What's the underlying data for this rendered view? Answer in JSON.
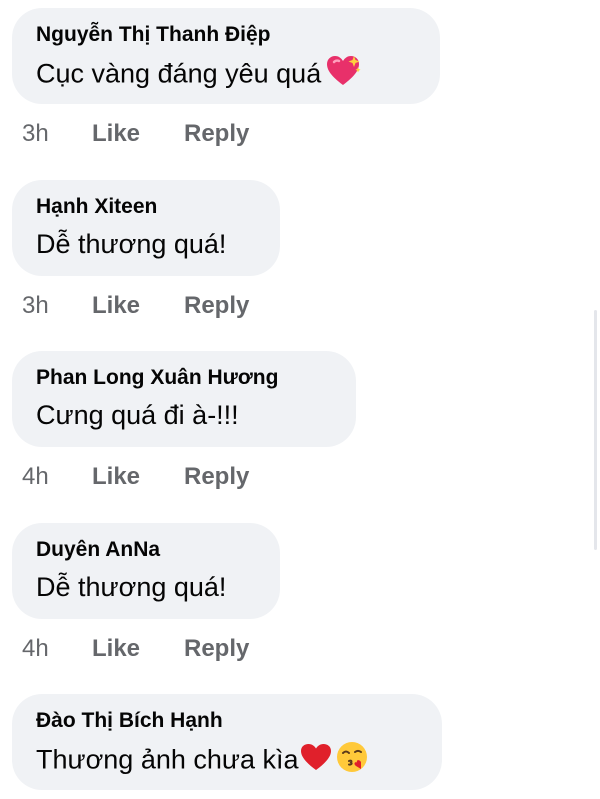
{
  "comments": [
    {
      "author": "Nguyễn Thị Thanh Điệp",
      "text": "Cục vàng đáng yêu quá",
      "emoji": "sparkling-heart",
      "time": "3h",
      "like": "Like",
      "reply": "Reply"
    },
    {
      "author": "Hạnh Xiteen",
      "text": "Dễ thương quá!",
      "time": "3h",
      "like": "Like",
      "reply": "Reply"
    },
    {
      "author": "Phan Long Xuân Hương",
      "text": "Cưng quá đi à-!!!",
      "time": "4h",
      "like": "Like",
      "reply": "Reply"
    },
    {
      "author": "Duyên AnNa",
      "text": "Dễ thương quá!",
      "time": "4h",
      "like": "Like",
      "reply": "Reply"
    },
    {
      "author": "Đào Thị Bích Hạnh",
      "text": "Thương ảnh chưa kìa",
      "emoji": "red-heart, face-blowing-kiss",
      "time": "",
      "like": "",
      "reply": ""
    }
  ]
}
